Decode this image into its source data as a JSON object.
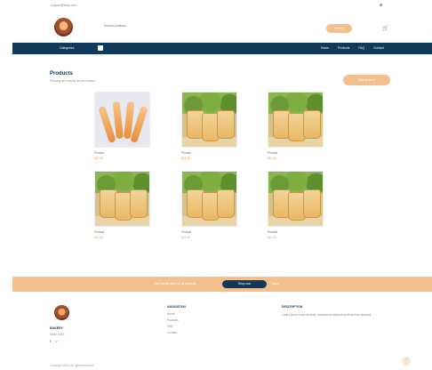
{
  "topbar": {
    "contact": "support@shop.com",
    "account_icon": "user-icon"
  },
  "header": {
    "search_placeholder": "Search products...",
    "search_button": "Search",
    "cart_icon": "cart-icon"
  },
  "nav": {
    "categories_label": "Categories",
    "links": [
      "Home",
      "Products",
      "FAQ",
      "Contact"
    ]
  },
  "page": {
    "title": "Products",
    "subtitle": "Showing all 6 results for your search",
    "sort_button": "Sort by latest"
  },
  "products": [
    {
      "name": "Product",
      "price": "$12.00",
      "image": "sticks"
    },
    {
      "name": "Product",
      "price": "$12.00",
      "image": "baskets"
    },
    {
      "name": "Product",
      "price": "$12.00",
      "image": "baskets"
    },
    {
      "name": "Product",
      "price": "$12.00",
      "image": "baskets"
    },
    {
      "name": "Product",
      "price": "$12.00",
      "image": "baskets"
    },
    {
      "name": "Product",
      "price": "$12.00",
      "image": "baskets"
    }
  ],
  "promo": {
    "text": "Get special offers on all products",
    "button": "Shop now",
    "after": "today"
  },
  "footer": {
    "brand": "BAKERY",
    "tagline": "Since 2020",
    "social_icons": [
      "facebook-icon",
      "instagram-icon"
    ],
    "col1_title": "NAVIGATION",
    "col1_links": [
      "Home",
      "Products",
      "FAQ",
      "Contact"
    ],
    "col2_title": "DESCRIPTION",
    "col2_text": "Lorem ipsum dolor sit amet, consectetur adipiscing elit sed do eiusmod.",
    "copyright": "Copyright 2024. All rights reserved"
  },
  "colors": {
    "navy": "#0f3a5c",
    "peach": "#f3bf8d"
  }
}
